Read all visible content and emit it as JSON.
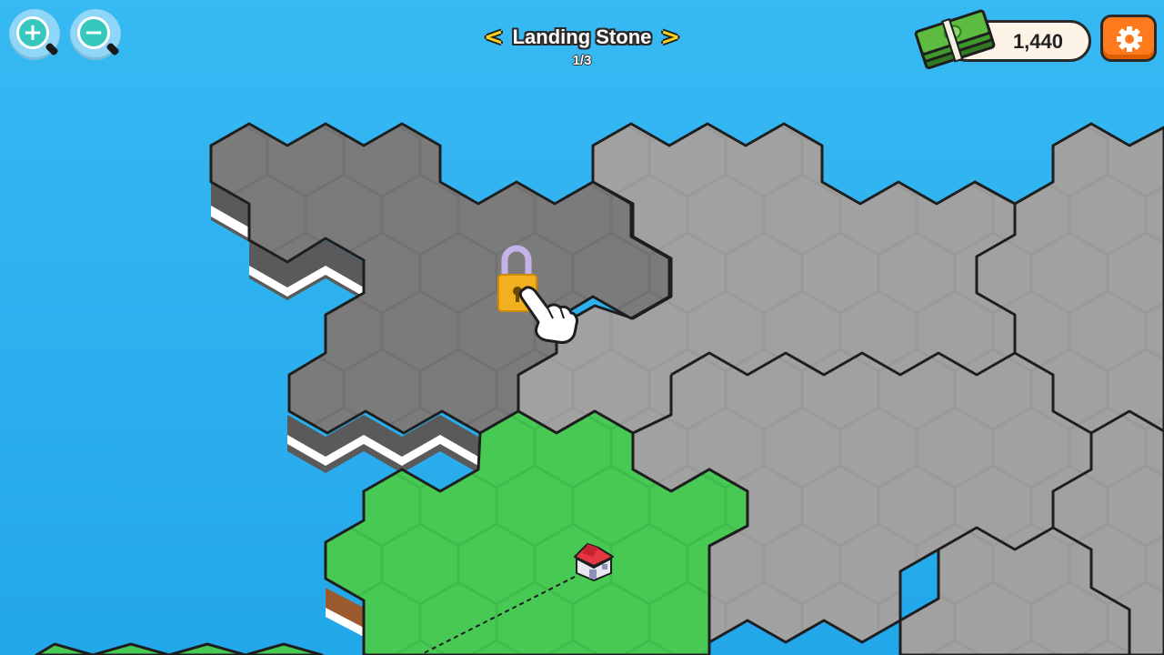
{
  "hud": {
    "zoom_in_label": "+",
    "zoom_out_label": "−",
    "level_title": "Landing Stone",
    "level_progress": "1/3",
    "prev_label": "<",
    "next_label": ">",
    "money": "1,440"
  },
  "colors": {
    "water": "#22a7ea",
    "grass": "#47c954",
    "locked_region_dark": "#7b7b7b",
    "locked_region_light": "#a1a1a1",
    "hud_accent": "#ffd21a",
    "settings_button": "#ff7a1c"
  },
  "icons": [
    "zoom-in-icon",
    "zoom-out-icon",
    "chevron-left-icon",
    "chevron-right-icon",
    "cash-stack-icon",
    "gear-icon",
    "padlock-icon",
    "pointing-hand-icon",
    "house-icon"
  ]
}
